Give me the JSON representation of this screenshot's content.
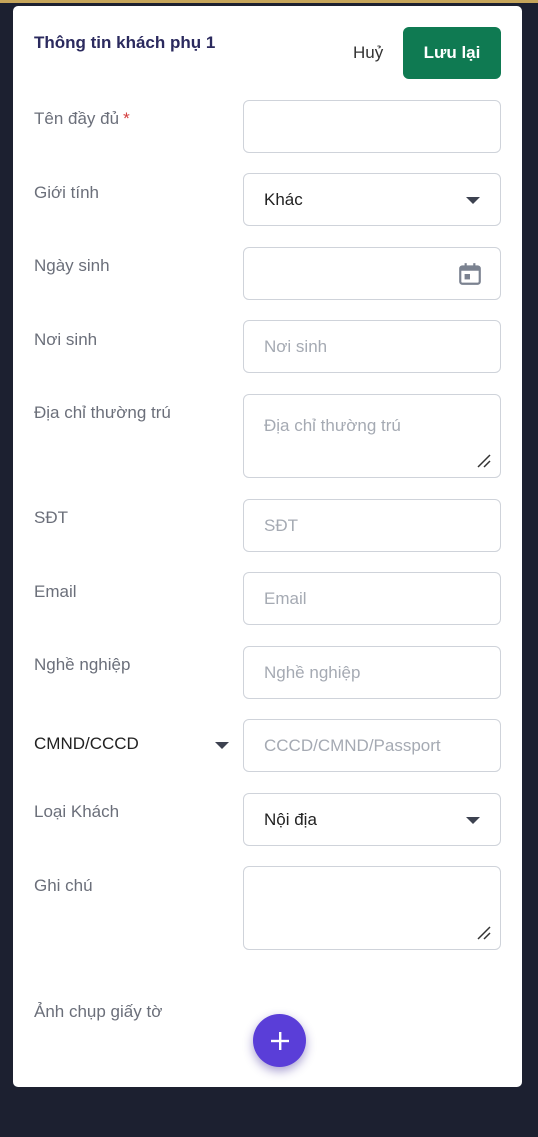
{
  "header": {
    "title": "Thông tin khách phụ 1",
    "cancel_label": "Huỷ",
    "save_label": "Lưu lại"
  },
  "form": {
    "full_name": {
      "label": "Tên đầy đủ",
      "required_mark": "*",
      "value": ""
    },
    "gender": {
      "label": "Giới tính",
      "value": "Khác"
    },
    "birth_date": {
      "label": "Ngày sinh",
      "value": ""
    },
    "birth_place": {
      "label": "Nơi sinh",
      "placeholder": "Nơi sinh"
    },
    "permanent_address": {
      "label": "Địa chỉ thường trú",
      "placeholder": "Địa chỉ thường trú"
    },
    "phone": {
      "label": "SĐT",
      "placeholder": "SĐT"
    },
    "email": {
      "label": "Email",
      "placeholder": "Email"
    },
    "occupation": {
      "label": "Nghề nghiệp",
      "placeholder": "Nghề nghiệp"
    },
    "id_document": {
      "type_value": "CMND/CCCD",
      "placeholder": "CCCD/CMND/Passport"
    },
    "guest_type": {
      "label": "Loại Khách",
      "value": "Nội địa"
    },
    "notes": {
      "label": "Ghi chú",
      "value": ""
    },
    "document_photo": {
      "label": "Ảnh chụp giấy tờ"
    }
  },
  "colors": {
    "save_button": "#0f7a52",
    "add_button": "#5a3ed8",
    "title": "#2b2a5e",
    "required": "#d33b3b"
  },
  "icons": [
    "calendar-icon",
    "resize-handle-icon",
    "chevron-down-icon",
    "plus-icon"
  ]
}
